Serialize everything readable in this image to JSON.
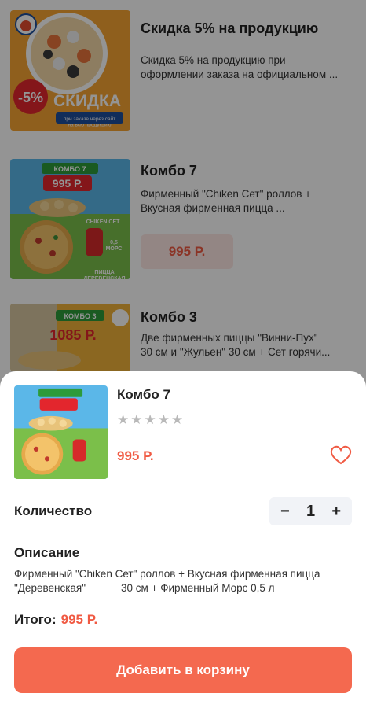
{
  "list": {
    "items": [
      {
        "title": "Скидка 5% на продукцию",
        "description": "Скидка 5% на продукцию при\nоформлении заказа на официальном ...",
        "banner_big": "-5%",
        "banner_text": "СКИДКА",
        "banner_small": "при заказе через сайт\nна всю продукцию"
      },
      {
        "title": "Комбо 7",
        "description": "Фирменный \"Chiken Сет\" роллов +\nВкусная фирменная пицца ...",
        "price": "995 Р.",
        "banner_head": "КОМБО 7",
        "banner_price": "995 Р.",
        "banner_set": "CHIKEN СЕТ",
        "banner_mors": "0,5\nМОРС",
        "banner_pizza": "ПИЦЦА\nДЕРЕВЕНСКАЯ"
      },
      {
        "title": "Комбо 3",
        "description": "Две фирменных пиццы \"Винни-Пух\"\n30 см и \"Жульен\" 30 см + Сет горячи...",
        "banner_head": "КОМБО 3",
        "banner_price": "1085 Р."
      }
    ]
  },
  "sheet": {
    "title": "Комбо 7",
    "rating_stars": 5,
    "rating_value": 0,
    "price": "995 Р.",
    "quantity_label": "Количество",
    "quantity": "1",
    "minus": "−",
    "plus": "+",
    "description_heading": "Описание",
    "description": "Фирменный \"Chiken Сет\" роллов + Вкусная фирменная пицца \"Деревенская\"            30 см + Фирменный Морс 0,5 л",
    "total_label": "Итого:",
    "total_value": "995 Р.",
    "add_button": "Добавить в корзину"
  },
  "colors": {
    "accent": "#f4694f",
    "price": "#f05a43",
    "star": "#b9b9b9",
    "overlay": "#000000"
  }
}
